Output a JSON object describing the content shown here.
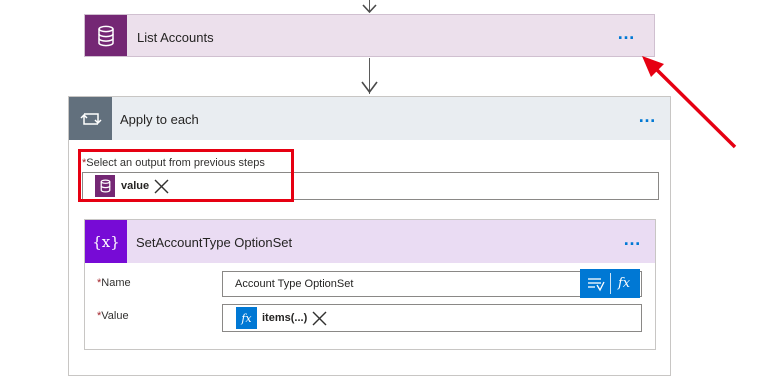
{
  "list_accounts": {
    "title": "List Accounts",
    "icon": "database-icon",
    "menu_label": "…"
  },
  "apply_to_each": {
    "title": "Apply to each",
    "icon": "loop-icon",
    "menu_label": "…",
    "select_output_label": "Select an output from previous steps",
    "required_marker": "*",
    "token_label": "value",
    "token_icon": "database-icon"
  },
  "set_variable": {
    "title": "SetAccountType OptionSet",
    "icon_label": "{x}",
    "menu_label": "…",
    "name_label": "Name",
    "name_value": "Account Type OptionSet",
    "value_label": "Value",
    "value_token_label": "items(...)",
    "value_token_icon_label": "fx",
    "required_marker": "*"
  },
  "dynamic_content_button": {
    "expression_label": "fx"
  },
  "colors": {
    "dataverse_purple": "#742774",
    "variable_purple": "#770bd6",
    "loop_gray": "#62707d",
    "accent_blue": "#0078d4",
    "annotation_red": "#e60012"
  }
}
